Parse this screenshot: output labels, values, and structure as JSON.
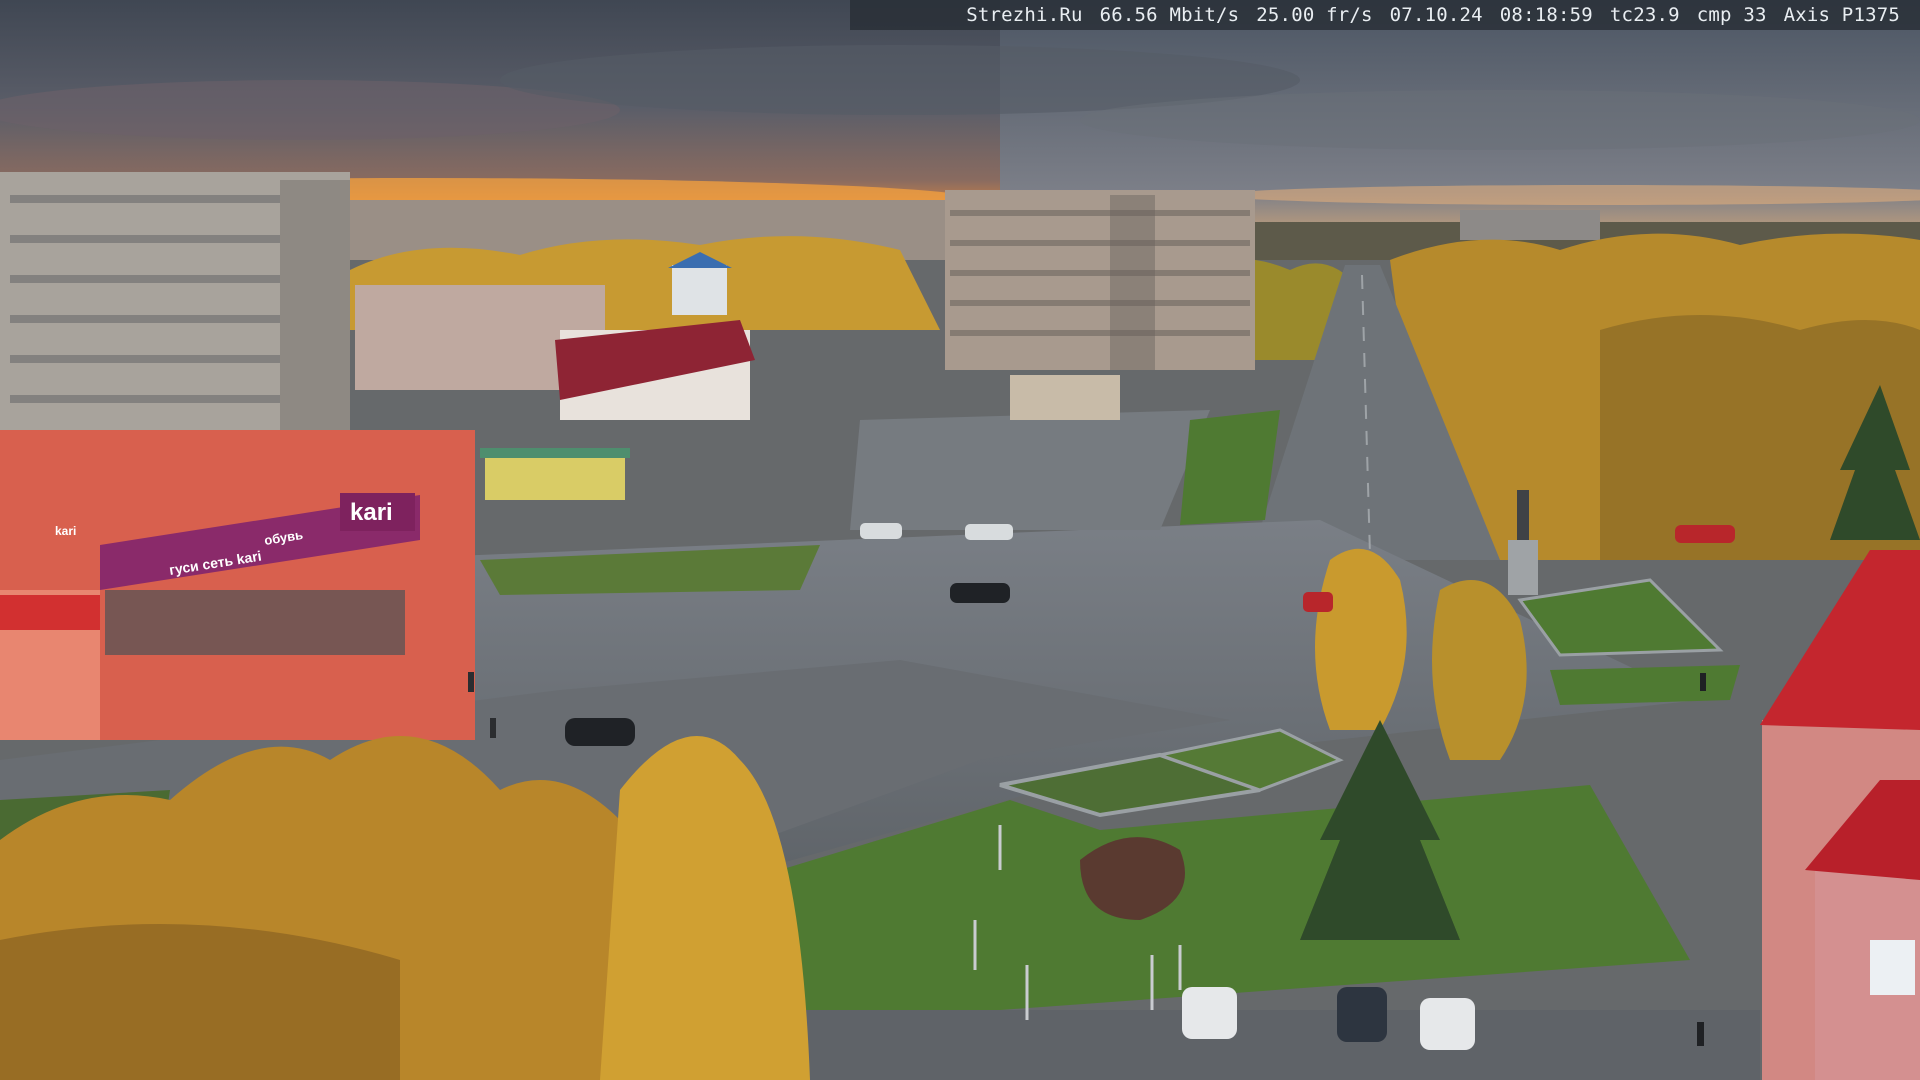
{
  "overlay": {
    "site": "Strezhi.Ru",
    "bitrate": "66.56 Mbit/s",
    "framerate": "25.00 fr/s",
    "date": "07.10.24",
    "time": "08:18:59",
    "tc": "tc23.9",
    "cmp": "cmp 33",
    "camera": "Axis P1375"
  },
  "signs": {
    "store_logo": "kari",
    "store_banner_1": "гуси сеть kari",
    "store_banner_2": "обувь",
    "store_side": "kari"
  },
  "colors": {
    "sky_top": "#4a5360",
    "sunset": "#f08a3a",
    "foliage": "#c99a2e",
    "asphalt": "#6c7075",
    "lawn": "#4f7a32",
    "store_facade": "#d8604e",
    "banner": "#8a2a6a"
  }
}
